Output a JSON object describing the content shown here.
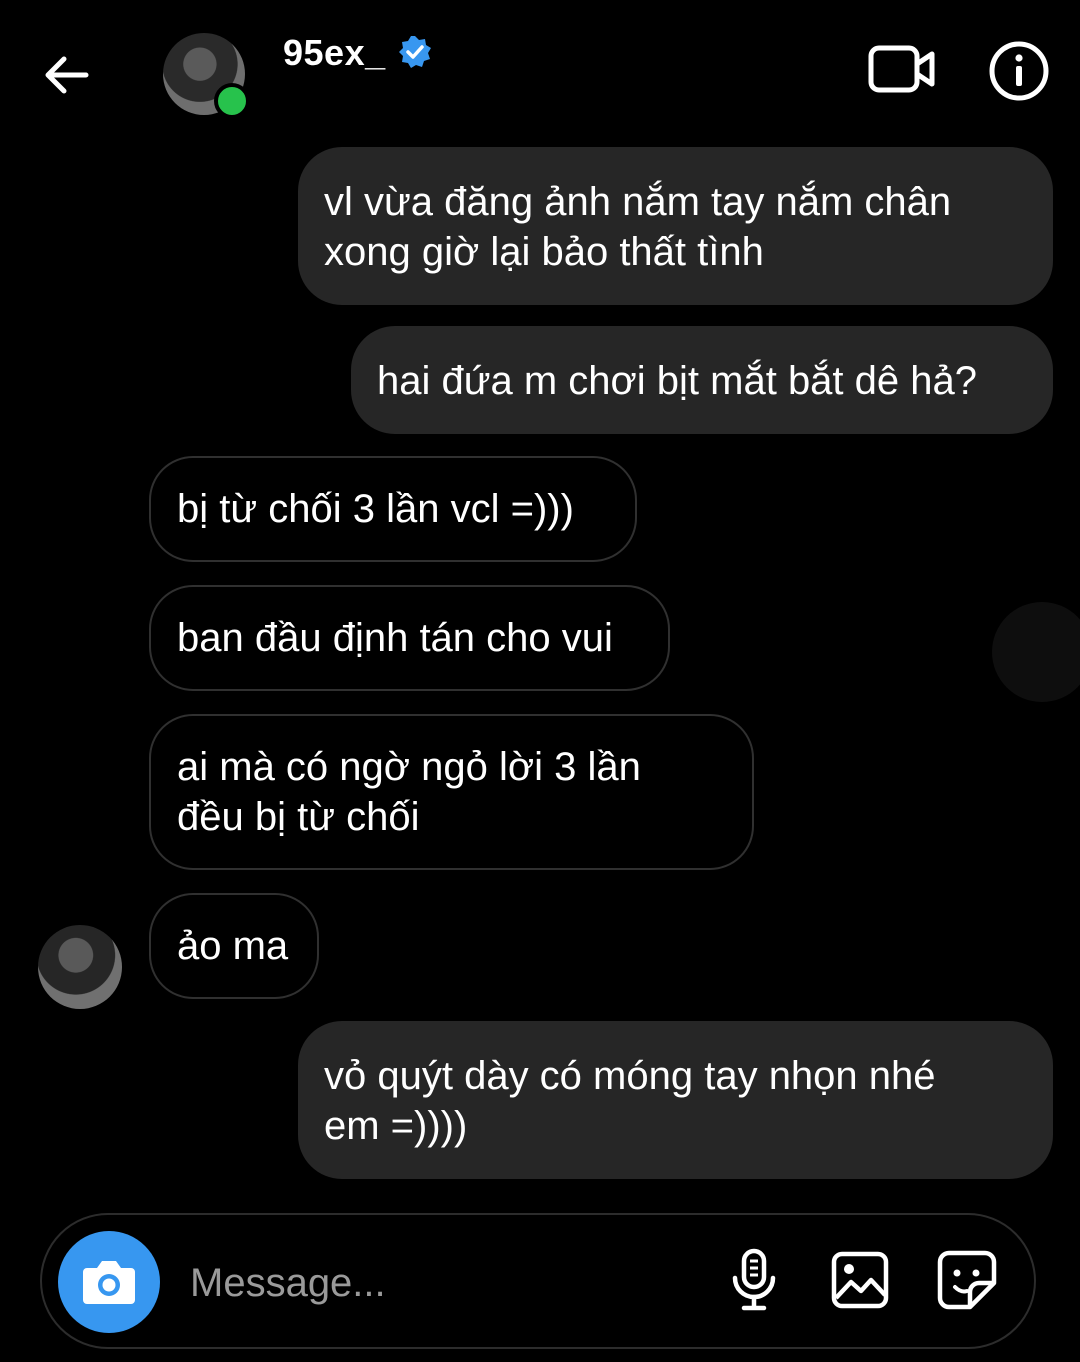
{
  "header": {
    "username": "95ex_",
    "verified": true,
    "online": true,
    "icons": {
      "back": "arrow-left-icon",
      "video": "video-camera-icon",
      "info": "info-icon",
      "verified": "verified-badge-icon"
    }
  },
  "messages": [
    {
      "direction": "outgoing",
      "lines": [
        "vl vừa đăng ảnh nắm tay nắm chân",
        "xong giờ lại bảo thất tình"
      ]
    },
    {
      "direction": "outgoing",
      "lines": [
        "hai đứa m chơi bịt mắt bắt dê hả?"
      ]
    },
    {
      "direction": "incoming",
      "lines": [
        "bị từ chối 3 lần vcl =)))"
      ]
    },
    {
      "direction": "incoming",
      "lines": [
        "ban đầu định tán cho vui"
      ]
    },
    {
      "direction": "incoming",
      "lines": [
        "ai mà có ngờ ngỏ lời 3 lần",
        "đều bị từ chối"
      ]
    },
    {
      "direction": "incoming",
      "lines": [
        "ảo ma"
      ]
    },
    {
      "direction": "outgoing",
      "lines": [
        "vỏ quýt dày có móng tay nhọn nhé",
        "em =))))"
      ]
    }
  ],
  "composer": {
    "placeholder": "Message...",
    "icons": {
      "camera": "camera-icon",
      "mic": "microphone-icon",
      "gallery": "image-gallery-icon",
      "sticker": "sticker-icon"
    }
  },
  "colors": {
    "background": "#000000",
    "outgoing_bubble": "#262626",
    "incoming_border": "#303030",
    "accent": "#3797f0",
    "online": "#27c24c",
    "verified": "#3897f0"
  }
}
